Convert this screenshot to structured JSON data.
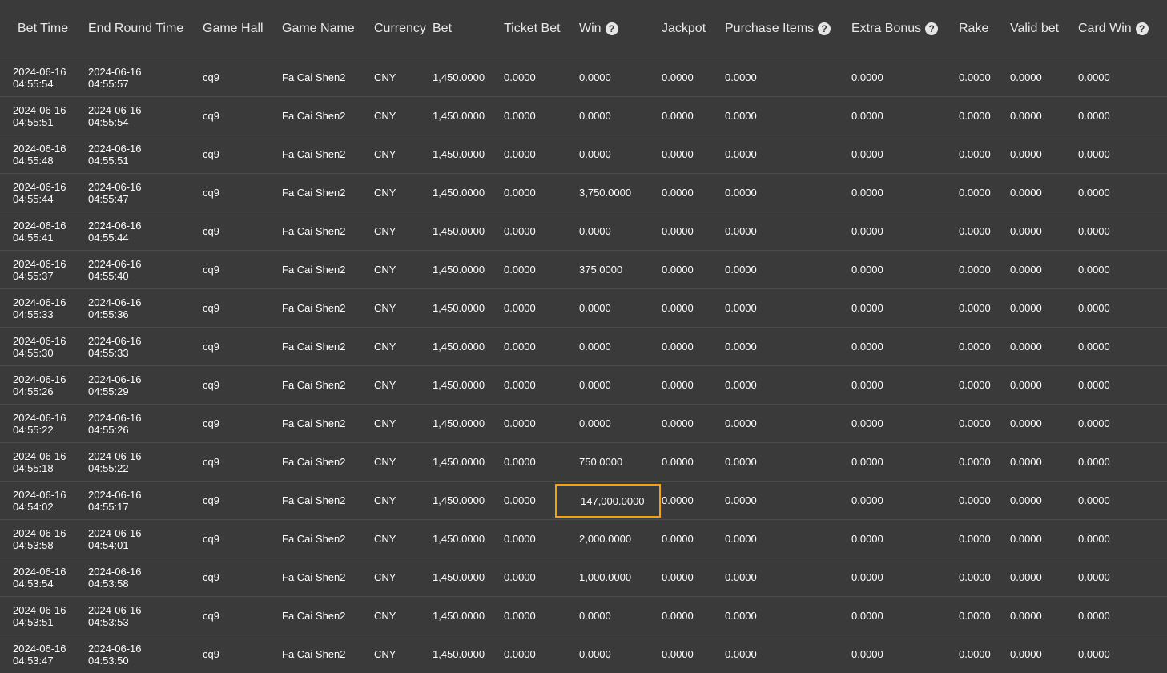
{
  "headers": {
    "bet_time": "Bet Time",
    "end_round_time": "End Round Time",
    "game_hall": "Game Hall",
    "game_name": "Game Name",
    "currency": "Currency",
    "bet": "Bet",
    "ticket_bet": "Ticket Bet",
    "win": "Win",
    "jackpot": "Jackpot",
    "purchase_items": "Purchase Items",
    "extra_bonus": "Extra Bonus",
    "rake": "Rake",
    "valid_bet": "Valid bet",
    "card_win": "Card Win",
    "help_glyph": "?"
  },
  "highlight_color": "#f0a30a",
  "rows": [
    {
      "bet_date": "2024-06-16",
      "bet_time": "04:55:54",
      "end_date": "2024-06-16",
      "end_time": "04:55:57",
      "hall": "cq9",
      "game": "Fa Cai Shen2",
      "currency": "CNY",
      "bet": "1,450.0000",
      "ticket_bet": "0.0000",
      "win": "0.0000",
      "jackpot": "0.0000",
      "purchase_items": "0.0000",
      "extra_bonus": "0.0000",
      "rake": "0.0000",
      "valid_bet": "0.0000",
      "card_win": "0.0000"
    },
    {
      "bet_date": "2024-06-16",
      "bet_time": "04:55:51",
      "end_date": "2024-06-16",
      "end_time": "04:55:54",
      "hall": "cq9",
      "game": "Fa Cai Shen2",
      "currency": "CNY",
      "bet": "1,450.0000",
      "ticket_bet": "0.0000",
      "win": "0.0000",
      "jackpot": "0.0000",
      "purchase_items": "0.0000",
      "extra_bonus": "0.0000",
      "rake": "0.0000",
      "valid_bet": "0.0000",
      "card_win": "0.0000"
    },
    {
      "bet_date": "2024-06-16",
      "bet_time": "04:55:48",
      "end_date": "2024-06-16",
      "end_time": "04:55:51",
      "hall": "cq9",
      "game": "Fa Cai Shen2",
      "currency": "CNY",
      "bet": "1,450.0000",
      "ticket_bet": "0.0000",
      "win": "0.0000",
      "jackpot": "0.0000",
      "purchase_items": "0.0000",
      "extra_bonus": "0.0000",
      "rake": "0.0000",
      "valid_bet": "0.0000",
      "card_win": "0.0000"
    },
    {
      "bet_date": "2024-06-16",
      "bet_time": "04:55:44",
      "end_date": "2024-06-16",
      "end_time": "04:55:47",
      "hall": "cq9",
      "game": "Fa Cai Shen2",
      "currency": "CNY",
      "bet": "1,450.0000",
      "ticket_bet": "0.0000",
      "win": "3,750.0000",
      "jackpot": "0.0000",
      "purchase_items": "0.0000",
      "extra_bonus": "0.0000",
      "rake": "0.0000",
      "valid_bet": "0.0000",
      "card_win": "0.0000"
    },
    {
      "bet_date": "2024-06-16",
      "bet_time": "04:55:41",
      "end_date": "2024-06-16",
      "end_time": "04:55:44",
      "hall": "cq9",
      "game": "Fa Cai Shen2",
      "currency": "CNY",
      "bet": "1,450.0000",
      "ticket_bet": "0.0000",
      "win": "0.0000",
      "jackpot": "0.0000",
      "purchase_items": "0.0000",
      "extra_bonus": "0.0000",
      "rake": "0.0000",
      "valid_bet": "0.0000",
      "card_win": "0.0000"
    },
    {
      "bet_date": "2024-06-16",
      "bet_time": "04:55:37",
      "end_date": "2024-06-16",
      "end_time": "04:55:40",
      "hall": "cq9",
      "game": "Fa Cai Shen2",
      "currency": "CNY",
      "bet": "1,450.0000",
      "ticket_bet": "0.0000",
      "win": "375.0000",
      "jackpot": "0.0000",
      "purchase_items": "0.0000",
      "extra_bonus": "0.0000",
      "rake": "0.0000",
      "valid_bet": "0.0000",
      "card_win": "0.0000"
    },
    {
      "bet_date": "2024-06-16",
      "bet_time": "04:55:33",
      "end_date": "2024-06-16",
      "end_time": "04:55:36",
      "hall": "cq9",
      "game": "Fa Cai Shen2",
      "currency": "CNY",
      "bet": "1,450.0000",
      "ticket_bet": "0.0000",
      "win": "0.0000",
      "jackpot": "0.0000",
      "purchase_items": "0.0000",
      "extra_bonus": "0.0000",
      "rake": "0.0000",
      "valid_bet": "0.0000",
      "card_win": "0.0000"
    },
    {
      "bet_date": "2024-06-16",
      "bet_time": "04:55:30",
      "end_date": "2024-06-16",
      "end_time": "04:55:33",
      "hall": "cq9",
      "game": "Fa Cai Shen2",
      "currency": "CNY",
      "bet": "1,450.0000",
      "ticket_bet": "0.0000",
      "win": "0.0000",
      "jackpot": "0.0000",
      "purchase_items": "0.0000",
      "extra_bonus": "0.0000",
      "rake": "0.0000",
      "valid_bet": "0.0000",
      "card_win": "0.0000"
    },
    {
      "bet_date": "2024-06-16",
      "bet_time": "04:55:26",
      "end_date": "2024-06-16",
      "end_time": "04:55:29",
      "hall": "cq9",
      "game": "Fa Cai Shen2",
      "currency": "CNY",
      "bet": "1,450.0000",
      "ticket_bet": "0.0000",
      "win": "0.0000",
      "jackpot": "0.0000",
      "purchase_items": "0.0000",
      "extra_bonus": "0.0000",
      "rake": "0.0000",
      "valid_bet": "0.0000",
      "card_win": "0.0000"
    },
    {
      "bet_date": "2024-06-16",
      "bet_time": "04:55:22",
      "end_date": "2024-06-16",
      "end_time": "04:55:26",
      "hall": "cq9",
      "game": "Fa Cai Shen2",
      "currency": "CNY",
      "bet": "1,450.0000",
      "ticket_bet": "0.0000",
      "win": "0.0000",
      "jackpot": "0.0000",
      "purchase_items": "0.0000",
      "extra_bonus": "0.0000",
      "rake": "0.0000",
      "valid_bet": "0.0000",
      "card_win": "0.0000"
    },
    {
      "bet_date": "2024-06-16",
      "bet_time": "04:55:18",
      "end_date": "2024-06-16",
      "end_time": "04:55:22",
      "hall": "cq9",
      "game": "Fa Cai Shen2",
      "currency": "CNY",
      "bet": "1,450.0000",
      "ticket_bet": "0.0000",
      "win": "750.0000",
      "jackpot": "0.0000",
      "purchase_items": "0.0000",
      "extra_bonus": "0.0000",
      "rake": "0.0000",
      "valid_bet": "0.0000",
      "card_win": "0.0000"
    },
    {
      "bet_date": "2024-06-16",
      "bet_time": "04:54:02",
      "end_date": "2024-06-16",
      "end_time": "04:55:17",
      "hall": "cq9",
      "game": "Fa Cai Shen2",
      "currency": "CNY",
      "bet": "1,450.0000",
      "ticket_bet": "0.0000",
      "win": "147,000.0000",
      "highlight": true,
      "jackpot": "0.0000",
      "purchase_items": "0.0000",
      "extra_bonus": "0.0000",
      "rake": "0.0000",
      "valid_bet": "0.0000",
      "card_win": "0.0000"
    },
    {
      "bet_date": "2024-06-16",
      "bet_time": "04:53:58",
      "end_date": "2024-06-16",
      "end_time": "04:54:01",
      "hall": "cq9",
      "game": "Fa Cai Shen2",
      "currency": "CNY",
      "bet": "1,450.0000",
      "ticket_bet": "0.0000",
      "win": "2,000.0000",
      "jackpot": "0.0000",
      "purchase_items": "0.0000",
      "extra_bonus": "0.0000",
      "rake": "0.0000",
      "valid_bet": "0.0000",
      "card_win": "0.0000"
    },
    {
      "bet_date": "2024-06-16",
      "bet_time": "04:53:54",
      "end_date": "2024-06-16",
      "end_time": "04:53:58",
      "hall": "cq9",
      "game": "Fa Cai Shen2",
      "currency": "CNY",
      "bet": "1,450.0000",
      "ticket_bet": "0.0000",
      "win": "1,000.0000",
      "jackpot": "0.0000",
      "purchase_items": "0.0000",
      "extra_bonus": "0.0000",
      "rake": "0.0000",
      "valid_bet": "0.0000",
      "card_win": "0.0000"
    },
    {
      "bet_date": "2024-06-16",
      "bet_time": "04:53:51",
      "end_date": "2024-06-16",
      "end_time": "04:53:53",
      "hall": "cq9",
      "game": "Fa Cai Shen2",
      "currency": "CNY",
      "bet": "1,450.0000",
      "ticket_bet": "0.0000",
      "win": "0.0000",
      "jackpot": "0.0000",
      "purchase_items": "0.0000",
      "extra_bonus": "0.0000",
      "rake": "0.0000",
      "valid_bet": "0.0000",
      "card_win": "0.0000"
    },
    {
      "bet_date": "2024-06-16",
      "bet_time": "04:53:47",
      "end_date": "2024-06-16",
      "end_time": "04:53:50",
      "hall": "cq9",
      "game": "Fa Cai Shen2",
      "currency": "CNY",
      "bet": "1,450.0000",
      "ticket_bet": "0.0000",
      "win": "0.0000",
      "jackpot": "0.0000",
      "purchase_items": "0.0000",
      "extra_bonus": "0.0000",
      "rake": "0.0000",
      "valid_bet": "0.0000",
      "card_win": "0.0000"
    }
  ]
}
